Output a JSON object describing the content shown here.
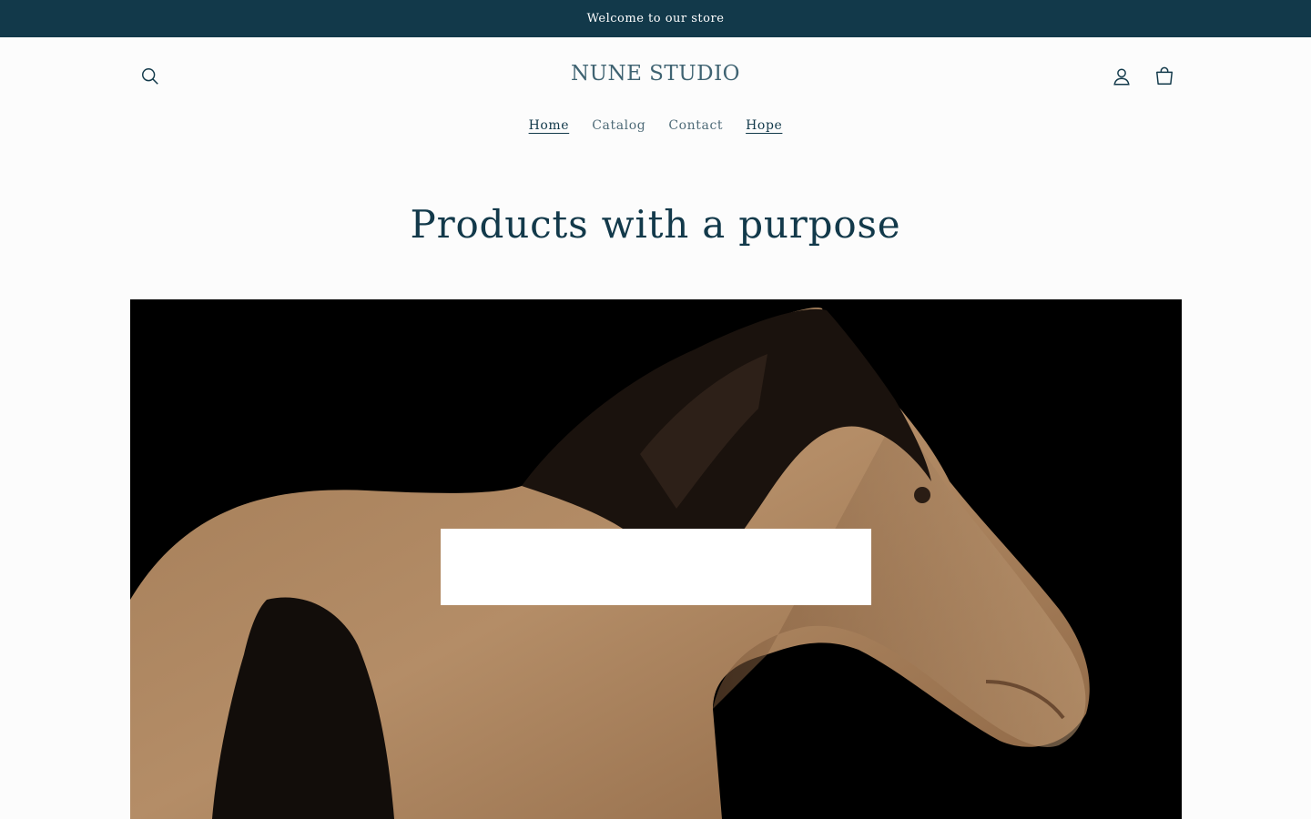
{
  "announcement": {
    "text": "Welcome to our store"
  },
  "header": {
    "logo": "NUNE STUDIO",
    "icons": {
      "search": "search-icon",
      "account": "account-icon",
      "cart": "cart-icon"
    }
  },
  "nav": {
    "items": [
      {
        "label": "Home"
      },
      {
        "label": "Catalog"
      },
      {
        "label": "Contact"
      },
      {
        "label": "Hope"
      }
    ]
  },
  "main": {
    "heading": "Products with a purpose"
  },
  "colors": {
    "accent": "#12394a",
    "background": "#fcfcfc",
    "hero_background": "#000000"
  }
}
